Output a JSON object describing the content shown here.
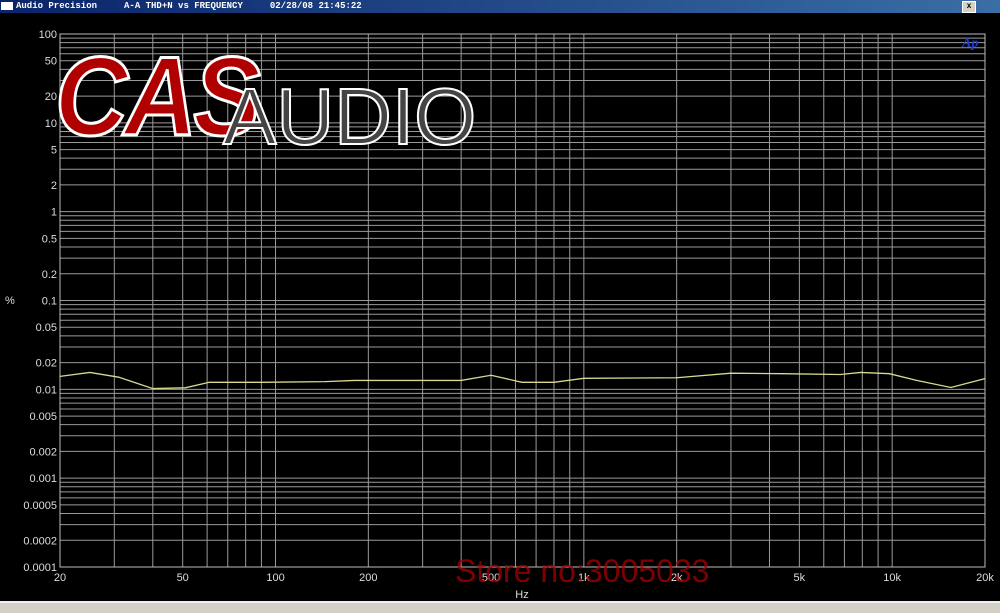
{
  "window": {
    "app": "Audio Precision",
    "title": "A-A THD+N vs FREQUENCY",
    "datetime": "02/28/08 21:45:22",
    "close_label": "x"
  },
  "logo": {
    "brand_red": "CAS",
    "brand_gray": "AUDIO",
    "ap_mark": "Ap"
  },
  "watermark": "Store no:3005033",
  "chart_data": {
    "type": "line",
    "title": "A-A THD+N vs FREQUENCY",
    "xlabel": "Hz",
    "ylabel": "%",
    "xscale": "log",
    "yscale": "log",
    "xlim": [
      20,
      20000
    ],
    "ylim": [
      0.0001,
      100
    ],
    "grid": true,
    "xticks": [
      20,
      50,
      100,
      200,
      500,
      1000,
      2000,
      5000,
      10000,
      20000
    ],
    "xtick_labels": [
      "20",
      "50",
      "100",
      "200",
      "500",
      "1k",
      "2k",
      "5k",
      "10k",
      "20k"
    ],
    "yticks": [
      100,
      50,
      20,
      10,
      5,
      2,
      1,
      0.5,
      0.2,
      0.1,
      0.05,
      0.02,
      0.01,
      0.005,
      0.002,
      0.001,
      0.0005,
      0.0002,
      0.0001
    ],
    "ytick_labels": [
      "100",
      "50",
      "20",
      "10",
      "5",
      "2",
      "1",
      "0.5",
      "0.2",
      "0.1",
      "0.05",
      "0.02",
      "0.01",
      "0.005",
      "0.002",
      "0.001",
      "0.0005",
      "0.0002",
      "0.0001"
    ],
    "series": [
      {
        "name": "THD+N",
        "color": "#d8d890",
        "x": [
          20,
          25,
          31,
          40,
          51,
          61,
          90,
          145,
          180,
          400,
          500,
          630,
          800,
          1000,
          2000,
          3000,
          4400,
          6800,
          7900,
          9800,
          12000,
          15500,
          20000
        ],
        "y": [
          0.014,
          0.0155,
          0.0137,
          0.0102,
          0.0104,
          0.012,
          0.012,
          0.0122,
          0.0126,
          0.0126,
          0.0144,
          0.012,
          0.012,
          0.0133,
          0.0135,
          0.0152,
          0.015,
          0.0147,
          0.0155,
          0.015,
          0.0126,
          0.0105,
          0.0132
        ]
      }
    ]
  }
}
